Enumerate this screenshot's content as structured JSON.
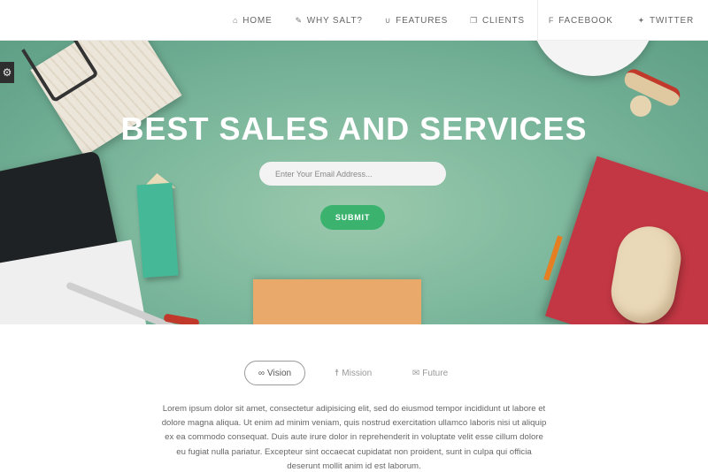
{
  "nav": {
    "items": [
      {
        "label": "HOME",
        "icon": "home-icon",
        "glyph": "⌂"
      },
      {
        "label": "WHY SALT?",
        "icon": "wand-icon",
        "glyph": "✎"
      },
      {
        "label": "FEATURES",
        "icon": "magnet-icon",
        "glyph": "∪"
      },
      {
        "label": "CLIENTS",
        "icon": "copy-icon",
        "glyph": "❐"
      },
      {
        "label": "FACEBOOK",
        "icon": "facebook-icon",
        "glyph": "f"
      },
      {
        "label": "TWITTER",
        "icon": "twitter-icon",
        "glyph": "✦"
      }
    ]
  },
  "hero": {
    "title": "BEST SALES AND SERVICES",
    "email_placeholder": "Enter Your Email Address...",
    "submit_label": "SUBMIT",
    "settings_glyph": "⚙"
  },
  "tabs": [
    {
      "label": "Vision",
      "icon": "infinity-icon",
      "glyph": "∞"
    },
    {
      "label": "Mission",
      "icon": "person-icon",
      "glyph": "☨"
    },
    {
      "label": "Future",
      "icon": "envelope-icon",
      "glyph": "✉"
    }
  ],
  "content": {
    "paragraph": "Lorem ipsum dolor sit amet, consectetur adipisicing elit, sed do eiusmod tempor incididunt ut labore et dolore magna aliqua. Ut enim ad minim veniam, quis nostrud exercitation ullamco laboris nisi ut aliquip ex ea commodo consequat. Duis aute irure dolor in reprehenderit in voluptate velit esse cillum dolore eu fugiat nulla pariatur. Excepteur sint occaecat cupidatat non proident, sunt in culpa qui officia deserunt mollit anim id est laborum."
  },
  "colors": {
    "accent": "#3bb36f",
    "hero_bg": "#7db89d"
  }
}
